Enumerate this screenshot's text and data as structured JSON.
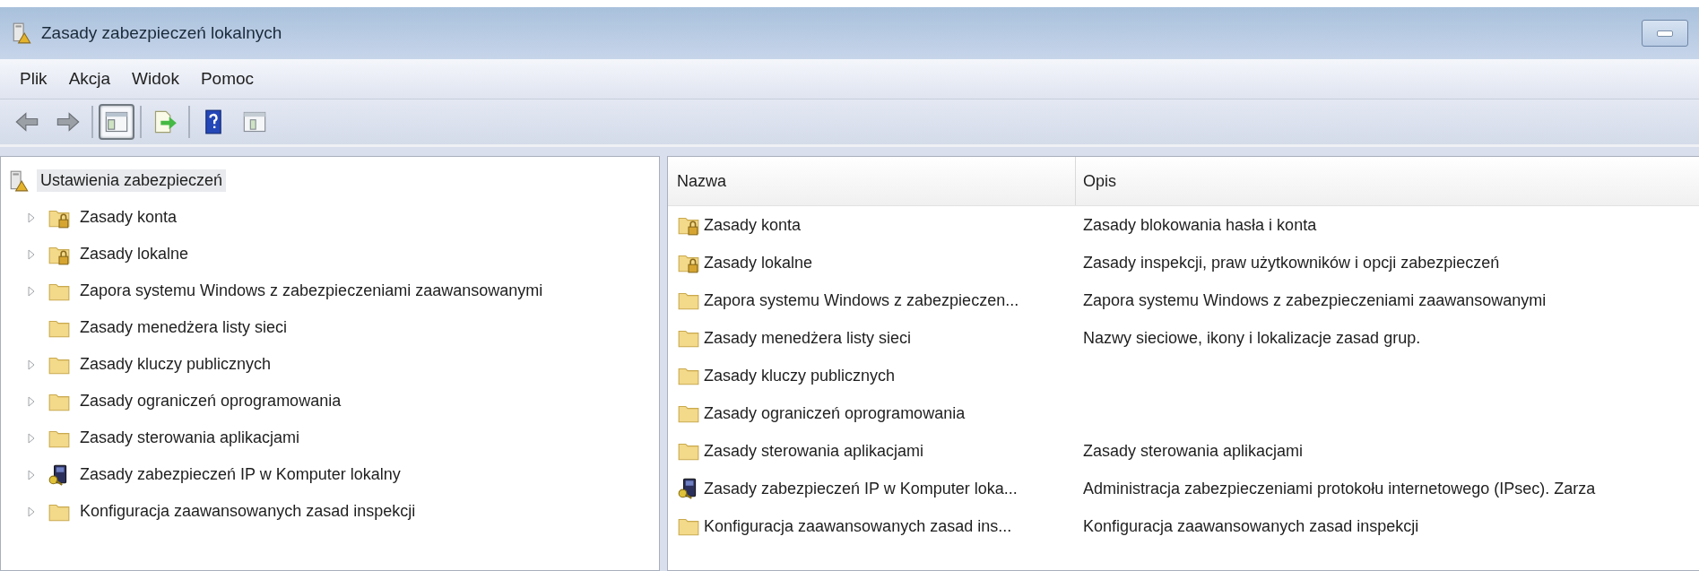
{
  "window": {
    "title": "Zasady zabezpieczeń lokalnych"
  },
  "menu": [
    "Plik",
    "Akcja",
    "Widok",
    "Pomoc"
  ],
  "toolbar": [
    {
      "kind": "back",
      "pressed": false
    },
    {
      "kind": "forward",
      "pressed": false
    },
    {
      "kind": "separator"
    },
    {
      "kind": "tree-toggle",
      "pressed": true
    },
    {
      "kind": "separator"
    },
    {
      "kind": "export",
      "pressed": false
    },
    {
      "kind": "separator"
    },
    {
      "kind": "help",
      "pressed": false
    },
    {
      "kind": "properties",
      "pressed": false
    }
  ],
  "tree": {
    "label": "Ustawienia zabezpieczeń",
    "selected": true,
    "kind": "security-settings",
    "children": [
      {
        "label": "Zasady konta",
        "kind": "security-folder",
        "expander": true,
        "selected": false
      },
      {
        "label": "Zasady lokalne",
        "kind": "security-folder",
        "expander": true,
        "selected": false
      },
      {
        "label": "Zapora systemu Windows z zabezpieczeniami zaawansowanymi",
        "kind": "folder",
        "expander": true,
        "selected": false
      },
      {
        "label": "Zasady menedżera listy sieci",
        "kind": "folder",
        "expander": false,
        "selected": false
      },
      {
        "label": "Zasady kluczy publicznych",
        "kind": "folder",
        "expander": true,
        "selected": false
      },
      {
        "label": "Zasady ograniczeń oprogramowania",
        "kind": "folder",
        "expander": true,
        "selected": false
      },
      {
        "label": "Zasady sterowania aplikacjami",
        "kind": "folder",
        "expander": true,
        "selected": false
      },
      {
        "label": "Zasady zabezpieczeń IP w Komputer lokalny",
        "kind": "ip-security",
        "expander": true,
        "selected": false
      },
      {
        "label": "Konfiguracja zaawansowanych zasad inspekcji",
        "kind": "folder",
        "expander": true,
        "selected": false
      }
    ]
  },
  "table": {
    "columns": [
      "Nazwa",
      "Opis"
    ],
    "rows": [
      {
        "kind": "security-folder",
        "name": "Zasady konta",
        "description": "Zasady blokowania hasła i konta"
      },
      {
        "kind": "security-folder",
        "name": "Zasady lokalne",
        "description": "Zasady inspekcji, praw użytkowników i opcji zabezpieczeń"
      },
      {
        "kind": "folder",
        "name": "Zapora systemu Windows z zabezpieczen...",
        "description": "Zapora systemu Windows z zabezpieczeniami zaawansowanymi"
      },
      {
        "kind": "folder",
        "name": "Zasady menedżera listy sieci",
        "description": "Nazwy sieciowe, ikony i lokalizacje zasad grup."
      },
      {
        "kind": "folder",
        "name": "Zasady kluczy publicznych"
      },
      {
        "kind": "folder",
        "name": "Zasady ograniczeń oprogramowania"
      },
      {
        "kind": "folder",
        "name": "Zasady sterowania aplikacjami",
        "description": "Zasady sterowania aplikacjami"
      },
      {
        "kind": "ip-security",
        "name": "Zasady zabezpieczeń IP w Komputer loka...",
        "description": "Administracja zabezpieczeniami protokołu internetowego (IPsec). Zarza"
      },
      {
        "kind": "folder",
        "name": "Konfiguracja zaawansowanych zasad ins...",
        "description": "Konfiguracja zaawansowanych zasad inspekcji"
      }
    ]
  }
}
